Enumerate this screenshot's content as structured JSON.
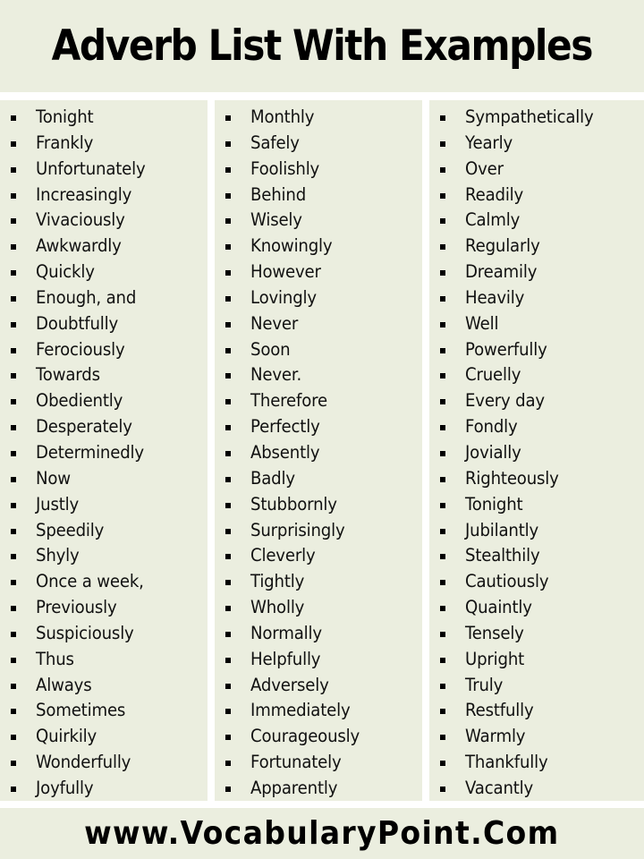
{
  "header": {
    "title": "Adverb List With Examples"
  },
  "colors": {
    "panel_background": "#ebeedf",
    "separator": "#ffffff",
    "text": "#000000"
  },
  "bullet_icon": "square-bullet-icon",
  "columns": [
    {
      "items": [
        "Tonight",
        "Frankly",
        "Unfortunately",
        "Increasingly",
        "Vivaciously",
        "Awkwardly",
        "Quickly",
        "Enough, and",
        "Doubtfully",
        "Ferociously",
        "Towards",
        "Obediently",
        "Desperately",
        "Determinedly",
        "Now",
        "Justly",
        "Speedily",
        "Shyly",
        "Once a week,",
        "Previously",
        "Suspiciously",
        "Thus",
        "Always",
        "Sometimes",
        "Quirkily",
        "Wonderfully",
        "Joyfully"
      ]
    },
    {
      "items": [
        "Monthly",
        "Safely",
        "Foolishly",
        "Behind",
        "Wisely",
        "Knowingly",
        "However",
        "Lovingly",
        "Never",
        "Soon",
        "Never.",
        "Therefore",
        "Perfectly",
        "Absently",
        "Badly",
        "Stubbornly",
        "Surprisingly",
        "Cleverly",
        "Tightly",
        "Wholly",
        "Normally",
        "Helpfully",
        "Adversely",
        "Immediately",
        "Courageously",
        "Fortunately",
        "Apparently"
      ]
    },
    {
      "items": [
        "Sympathetically",
        "Yearly",
        "Over",
        "Readily",
        "Calmly",
        "Regularly",
        "Dreamily",
        "Heavily",
        "Well",
        "Powerfully",
        "Cruelly",
        "Every day",
        "Fondly",
        "Jovially",
        "Righteously",
        "Tonight",
        "Jubilantly",
        "Stealthily",
        "Cautiously",
        "Quaintly",
        "Tensely",
        "Upright",
        "Truly",
        "Restfully",
        "Warmly",
        "Thankfully",
        "Vacantly"
      ]
    }
  ],
  "footer": {
    "website": "www.VocabularyPoint.Com"
  }
}
